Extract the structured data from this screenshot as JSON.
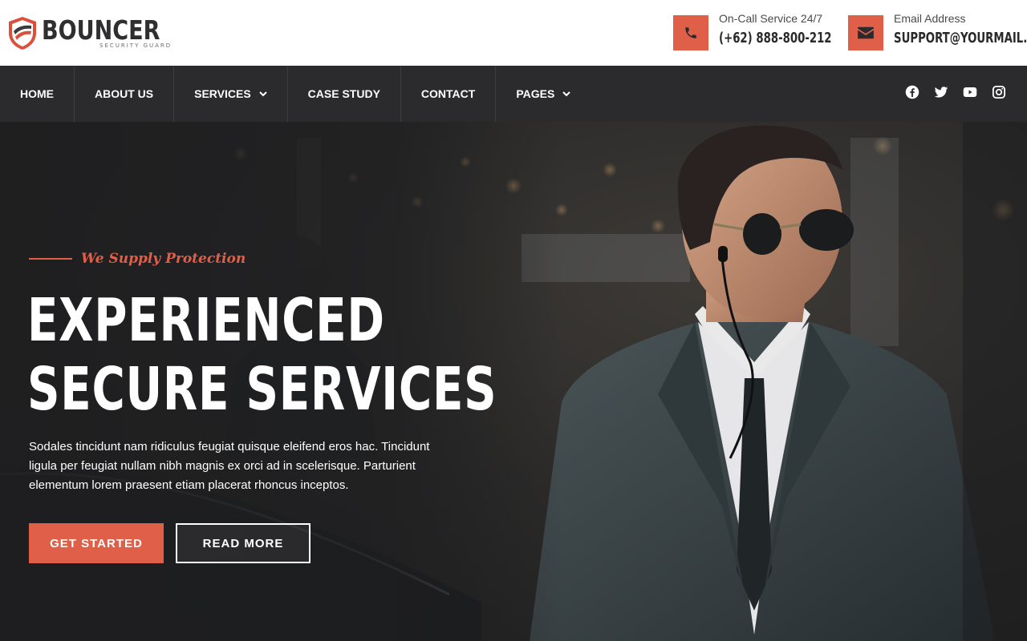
{
  "brand": {
    "name": "BOUNCER",
    "tagline": "SECURITY GUARD",
    "accent": "#e05f48",
    "dark": "#2b2b2d"
  },
  "contact": {
    "phone": {
      "label": "On-Call Service 24/7",
      "value": "(+62) 888-800-212",
      "icon": "phone-icon"
    },
    "email": {
      "label": "Email Address",
      "value": "SUPPORT@YOURMAIL.TLD",
      "icon": "envelope-icon"
    }
  },
  "nav": {
    "items": [
      {
        "label": "HOME",
        "dropdown": false
      },
      {
        "label": "ABOUT US",
        "dropdown": false
      },
      {
        "label": "SERVICES",
        "dropdown": true
      },
      {
        "label": "CASE STUDY",
        "dropdown": false
      },
      {
        "label": "CONTACT",
        "dropdown": false
      },
      {
        "label": "PAGES",
        "dropdown": true
      }
    ],
    "socials": [
      "facebook-icon",
      "twitter-icon",
      "youtube-icon",
      "instagram-icon"
    ]
  },
  "hero": {
    "eyebrow": "We Supply Protection",
    "title_line1": "EXPERIENCED",
    "title_line2": "SECURE SERVICES",
    "description": "Sodales tincidunt nam ridiculus feugiat quisque eleifend eros hac. Tincidunt ligula per feugiat nullam nibh magnis ex orci ad in scelerisque. Parturient elementum lorem praesent etiam placerat rhoncus inceptos.",
    "primary_button": "GET STARTED",
    "secondary_button": "READ MORE"
  }
}
